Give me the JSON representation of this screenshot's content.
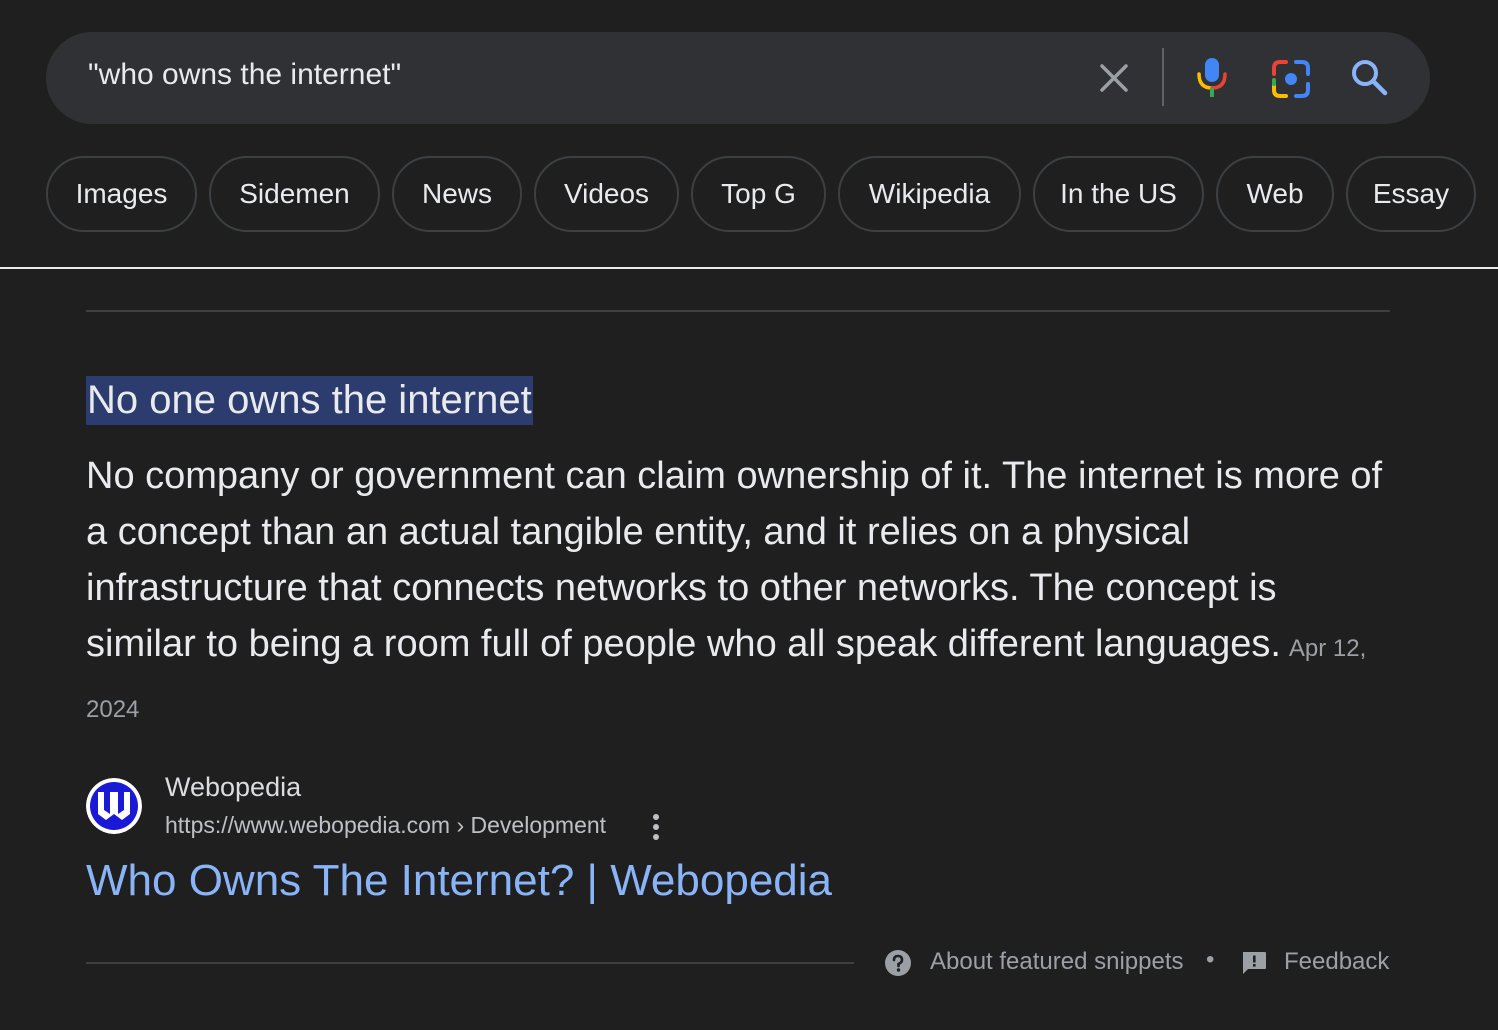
{
  "search": {
    "query": "\"who owns the internet\"",
    "icons": [
      "close-icon",
      "microphone-icon",
      "google-lens-icon",
      "search-icon"
    ]
  },
  "chips": [
    {
      "label": "Images"
    },
    {
      "label": "Sidemen"
    },
    {
      "label": "News"
    },
    {
      "label": "Videos"
    },
    {
      "label": "Top G"
    },
    {
      "label": "Wikipedia"
    },
    {
      "label": "In the US"
    },
    {
      "label": "Web"
    },
    {
      "label": "Essay"
    }
  ],
  "snippet": {
    "answer": "No one owns the internet",
    "text": "No company or government can claim ownership of it. The internet is more of a concept than an actual tangible entity, and it relies on a physical infrastructure that connects networks to other networks. The concept is similar to being a room full of people who all speak different languages.",
    "date": "Apr 12, 2024",
    "answer_highlight_color": "#2c3c6e"
  },
  "source": {
    "site_name": "Webopedia",
    "url": "https://www.webopedia.com › Development",
    "title": "Who Owns The Internet? | Webopedia",
    "favicon": "webopedia-logo",
    "link_color": "#8ab4f8"
  },
  "footer": {
    "about_label": "About featured snippets",
    "separator": "•",
    "feedback_label": "Feedback"
  },
  "colors": {
    "background": "#1f1f1f",
    "search_bar": "#303134",
    "text": "#e8eaed"
  }
}
